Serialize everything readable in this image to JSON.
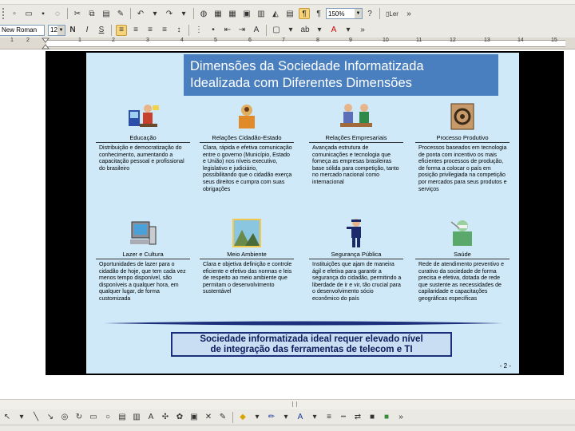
{
  "toolbar": {
    "zoom_value": "150%",
    "read_label": "Ler",
    "font_name": "New Roman",
    "font_size": "12"
  },
  "ruler": {
    "numbers": [
      "1",
      "2",
      "1",
      "2",
      "3",
      "4",
      "5",
      "6",
      "7",
      "8",
      "9",
      "10",
      "11",
      "12",
      "13",
      "14",
      "15"
    ]
  },
  "slide": {
    "title_line1": "Dimensões da Sociedade Informatizada",
    "title_line2": "Idealizada com Diferentes Dimensões",
    "cells": [
      {
        "label": "Educação",
        "text": "Distribuição e democratização do conhecimento, aumentando a capacitação pessoal e profissional do brasileiro"
      },
      {
        "label": "Relações Cidadão-Estado",
        "text": "Clara, rápida e efetiva comunicação entre o governo (Município, Estado e União) nos níveis executivo, legislativo e judiciário, possibilitando que o cidadão exerça seus direitos e cumpra com suas obrigações"
      },
      {
        "label": "Relações Empresariais",
        "text": "Avançada estrutura de comunicações e tecnologia que forneça as empresas brasileiras base sólida para competição, tanto no mercado nacional como internacional"
      },
      {
        "label": "Processo Produtivo",
        "text": "Processos baseados em tecnologia de ponta com incentivo os mais eficientes processos de produção, de forma a colocar o país em posição privilegiada na competição por mercados para seus produtos e serviços"
      },
      {
        "label": "Lazer e Cultura",
        "text": "Oportunidades de lazer para o cidadão de hoje, que tem cada vez menos tempo disponível, são disponíveis a qualquer hora, em qualquer lugar, de forma customizada"
      },
      {
        "label": "Meio Ambiente",
        "text": "Clara e objetiva definição e controle eficiente e efetivo das normas e leis de respeito ao meio ambiente que permitam o desenvolvimento sustentável"
      },
      {
        "label": "Segurança Pública",
        "text": "Instituições que ajam de maneira ágil e efetiva para garantir a segurança do cidadão, permitindo a liberdade de ir e vir, tão crucial para o desenvolvimento sócio econômico do país"
      },
      {
        "label": "Saúde",
        "text": "Rede de atendimento preventivo e curativo da sociedade de forma precisa e efetiva, dotada de rede que sustente as necessidades de capilaridade e capacitações geográficas específicas"
      }
    ],
    "conclusion_line1": "Sociedade informatizada ideal requer elevado nível",
    "conclusion_line2": "de integração das ferramentas de telecom e TI",
    "page_number": "- 2 -"
  },
  "colors": {
    "slide_bg": "#cfe9f8",
    "title_bg": "#4a7fbf",
    "frame": "#000000",
    "conclusion_border": "#1c2f7a"
  }
}
